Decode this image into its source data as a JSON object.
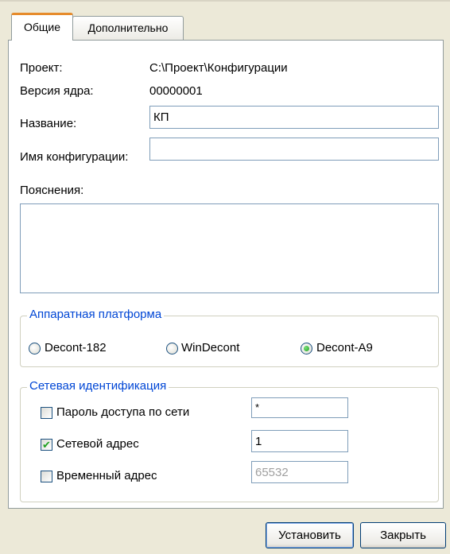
{
  "tabs": [
    {
      "label": "Общие",
      "active": true
    },
    {
      "label": "Дополнительно",
      "active": false
    }
  ],
  "general": {
    "project_label": "Проект:",
    "project_value": "C:\\Проект\\Конфигурации",
    "core_version_label": "Версия ядра:",
    "core_version_value": "00000001",
    "name_label": "Название:",
    "name_value": "КП",
    "config_name_label": "Имя конфигурации:",
    "config_name_value": "",
    "notes_label": "Пояснения:",
    "notes_value": ""
  },
  "hardware_platform": {
    "title": "Аппаратная платформа",
    "options": [
      {
        "label": "Decont-182",
        "selected": false
      },
      {
        "label": "WinDecont",
        "selected": false
      },
      {
        "label": "Decont-A9",
        "selected": true
      }
    ]
  },
  "network_id": {
    "title": "Сетевая идентификация",
    "password": {
      "label": "Пароль доступа по сети",
      "checked": false,
      "value": "*"
    },
    "network_address": {
      "label": "Сетевой адрес",
      "checked": true,
      "value": "1"
    },
    "temp_address": {
      "label": "Временный адрес",
      "checked": false,
      "value": "65532",
      "disabled": true
    }
  },
  "buttons": {
    "install": "Установить",
    "close": "Закрыть"
  },
  "colors": {
    "dialog_bg": "#ece9d8",
    "active_tab_accent": "#e68b2c",
    "group_title": "#0046d5",
    "field_border": "#7f9db9",
    "check_mark": "#21a121"
  }
}
